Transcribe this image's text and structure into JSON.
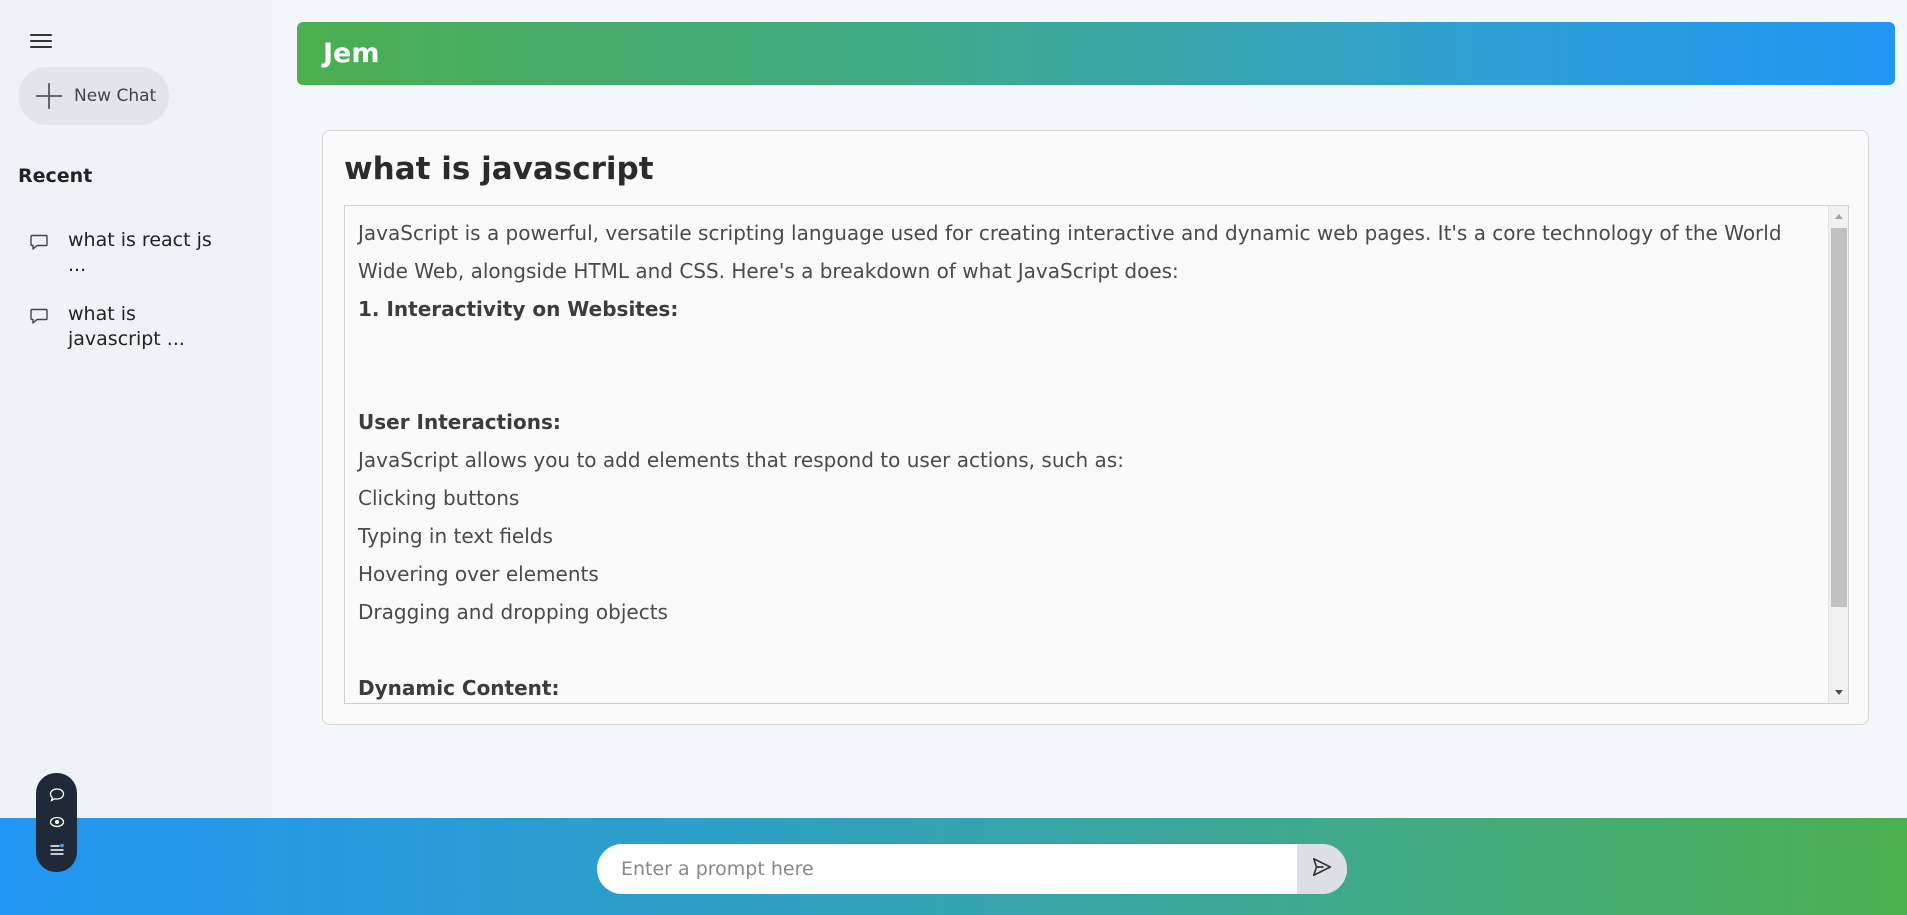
{
  "sidebar": {
    "menu_icon": "hamburger-menu-icon",
    "new_chat_label": "New Chat",
    "recent_title": "Recent",
    "recent_items": [
      {
        "label": "what is react js ..."
      },
      {
        "label": "what is javascript ..."
      }
    ]
  },
  "header": {
    "title": "Jem"
  },
  "main": {
    "question": "what is javascript",
    "answer": {
      "intro": "JavaScript is a powerful, versatile scripting language used for creating interactive and dynamic web pages. It's a core technology of the World Wide Web, alongside HTML and CSS. Here's a breakdown of what JavaScript does:",
      "heading1": "1. Interactivity on Websites:",
      "subheading1": "User Interactions:",
      "subheading1_text": "JavaScript allows you to add elements that respond to user actions, such as:",
      "list": [
        "Clicking buttons",
        "Typing in text fields",
        "Hovering over elements",
        "Dragging and dropping objects"
      ],
      "subheading2": "Dynamic Content:"
    }
  },
  "prompt": {
    "placeholder": "Enter a prompt here",
    "value": ""
  },
  "colors": {
    "header_gradient_start": "#4caf50",
    "header_gradient_end": "#2196f3",
    "bottom_gradient_start": "#2196f3",
    "bottom_gradient_end": "#4caf50",
    "float_pill": "#1f2937"
  }
}
